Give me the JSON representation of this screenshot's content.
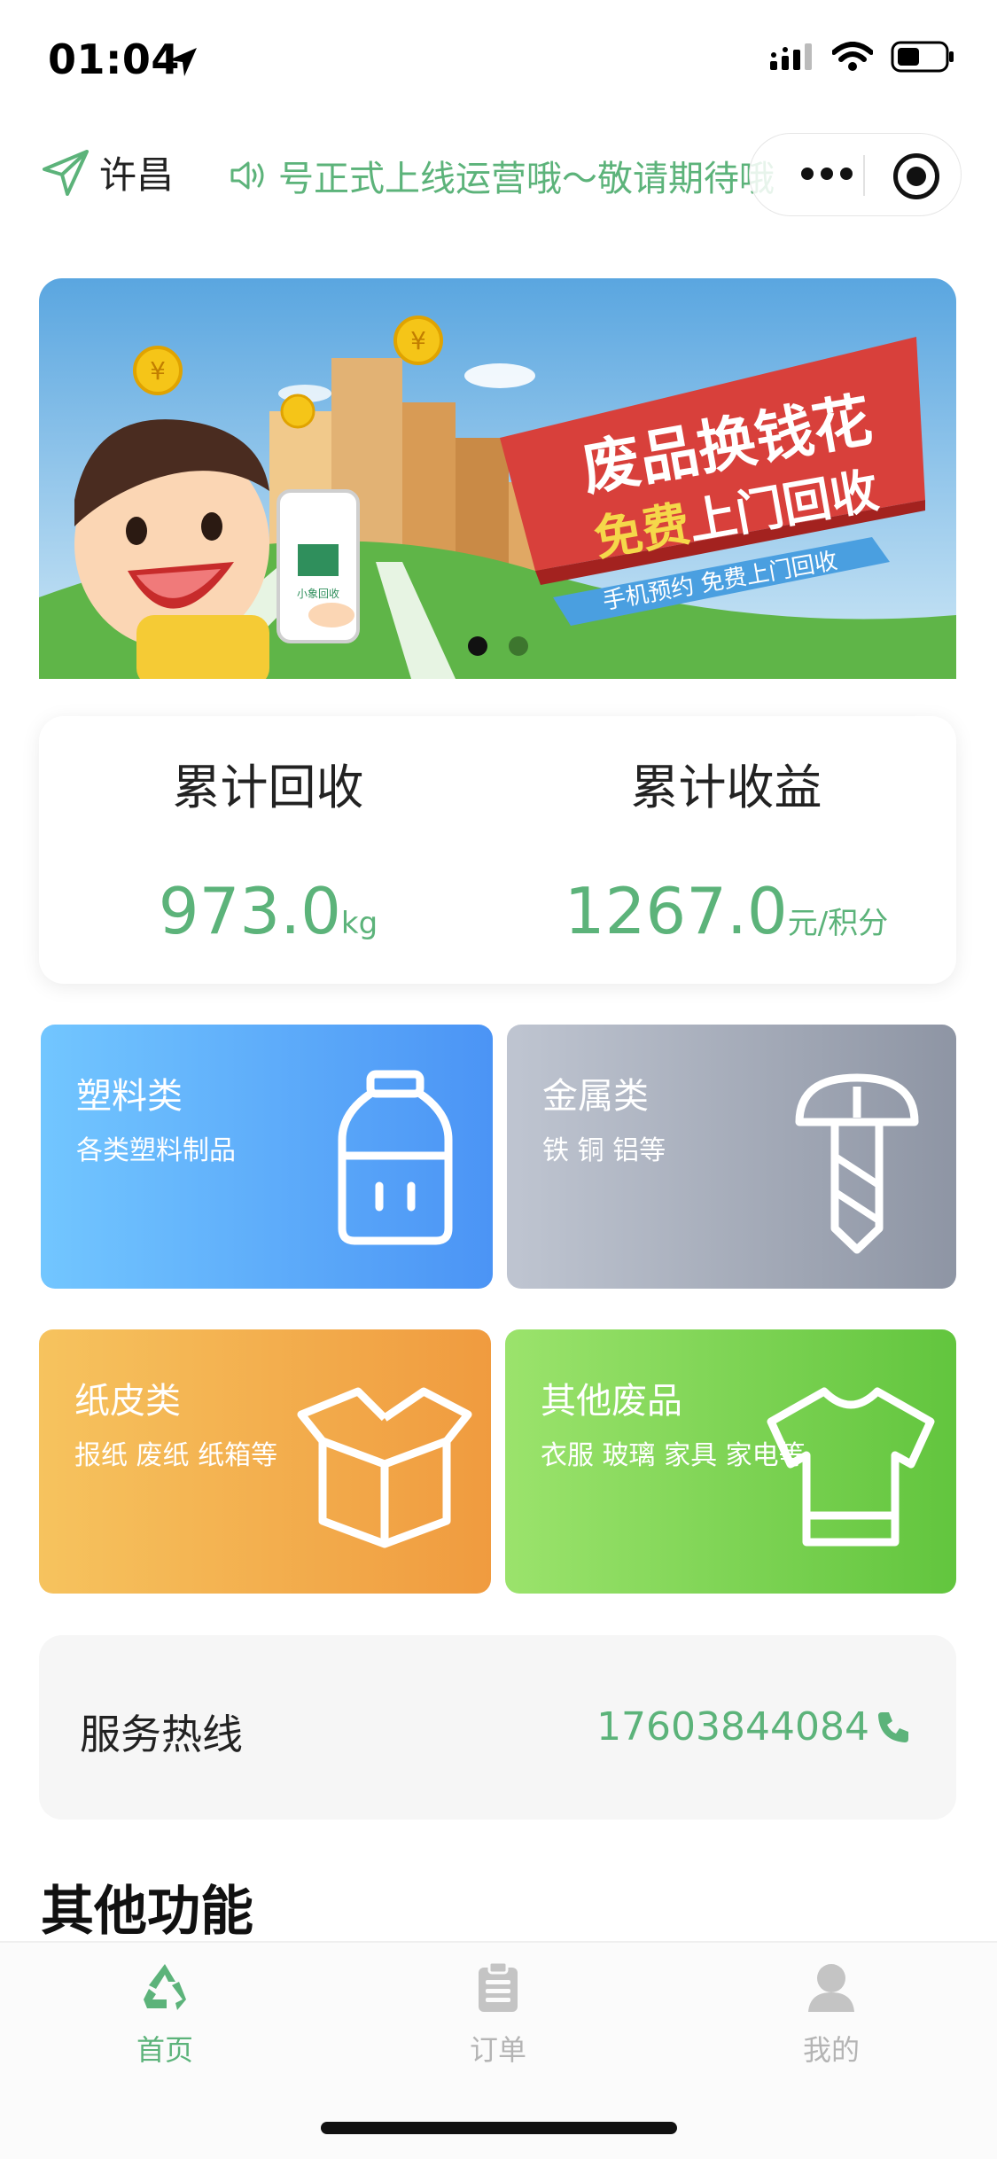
{
  "status_bar": {
    "time": "01:04"
  },
  "top_nav": {
    "city": "许昌",
    "notice": "号正式上线运营哦～敬请期待哦"
  },
  "banner": {
    "headline": "废品换钱花",
    "subline_highlight": "免费",
    "subline_rest": "上门回收",
    "ribbon": "手机预约 免费上门回收",
    "phone_label": "小象回收",
    "active_slide": 1,
    "slide_count": 2
  },
  "stats": {
    "recycled": {
      "title": "累计回收",
      "value": "973.0",
      "unit": "kg"
    },
    "earnings": {
      "title": "累计收益",
      "value": "1267.0",
      "unit": "元/积分"
    }
  },
  "categories": [
    {
      "title": "塑料类",
      "subtitle": "各类塑料制品",
      "icon": "bottle-icon"
    },
    {
      "title": "金属类",
      "subtitle": "铁 铜 铝等",
      "icon": "screw-icon"
    },
    {
      "title": "纸皮类",
      "subtitle": "报纸 废纸 纸箱等",
      "icon": "box-icon"
    },
    {
      "title": "其他废品",
      "subtitle": "衣服 玻璃 家具 家电等",
      "icon": "shirt-icon"
    }
  ],
  "hotline": {
    "label": "服务热线",
    "phone": "17603844084"
  },
  "section": {
    "title": "其他功能"
  },
  "tabbar": {
    "items": [
      {
        "label": "首页",
        "icon": "recycle-icon",
        "active": true
      },
      {
        "label": "订单",
        "icon": "clipboard-icon",
        "active": false
      },
      {
        "label": "我的",
        "icon": "user-icon",
        "active": false
      }
    ]
  },
  "colors": {
    "accent_green": "#5cb37a",
    "plastic": "#4b94f5",
    "metal": "#8e95a4",
    "paper": "#f09b3f",
    "other": "#62c53e"
  }
}
